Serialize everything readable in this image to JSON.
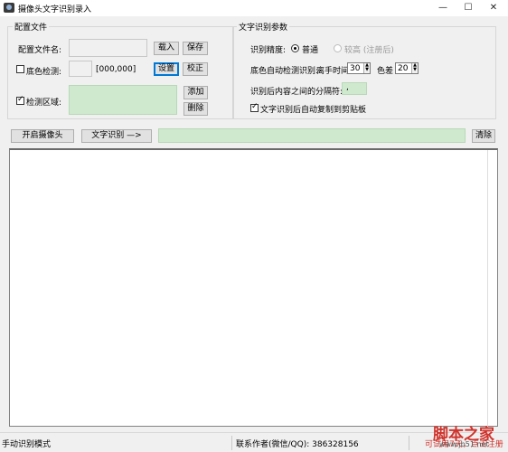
{
  "window": {
    "title": "摄像头文字识别录入",
    "minimize_glyph": "—",
    "maximize_glyph": "☐",
    "close_glyph": "✕"
  },
  "config_group": {
    "title": "配置文件",
    "filename_label": "配置文件名:",
    "filename_value": "",
    "load_button": "载入",
    "save_button": "保存",
    "bg_check_label": "底色检测:",
    "bg_check_checked": false,
    "bg_color_readout": "[000,000]",
    "set_button": "设置",
    "calibrate_button": "校正",
    "region_label": "检测区域:",
    "region_checked": true,
    "add_button": "添加",
    "delete_button": "删除"
  },
  "ocr_group": {
    "title": "文字识别参数",
    "accuracy_label": "识别精度:",
    "accuracy_normal": "普通",
    "accuracy_high": "较高 (注册后)",
    "accuracy_selected": "普通",
    "auto_label": "底色自动检测识别:",
    "delay_label": "离手时间",
    "delay_value": "30",
    "color_diff_label": "色差",
    "color_diff_value": "20",
    "separator_label": "识别后内容之间的分隔符:",
    "separator_value": ",",
    "auto_copy_label": "文字识别后自动复制到剪贴板",
    "auto_copy_checked": true
  },
  "toolbar": {
    "open_camera": "开启摄像头",
    "ocr_button": "文字识别 —>",
    "result_value": "",
    "clear_button": "清除"
  },
  "status": {
    "mode": "手动识别模式",
    "contact": "联系作者(微信/QQ): 386328156",
    "trial": "可试用7天，点击注册"
  },
  "watermark": {
    "text": "脚本之家",
    "url": "www.jb51.net"
  },
  "colors": {
    "green_field": "#cfe9cf",
    "focus_blue": "#0078d7",
    "trial_red": "#d0332c"
  }
}
